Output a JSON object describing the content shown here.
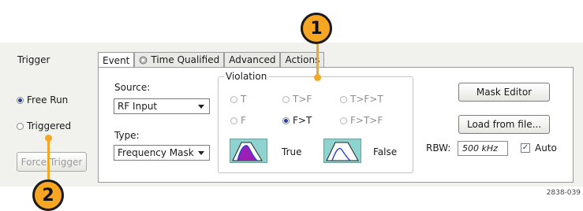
{
  "trigger": {
    "title": "Trigger",
    "free_run_label": "Free Run",
    "triggered_label": "Triggered",
    "force_trigger_label": "Force Trigger",
    "mode_selected": "Free Run"
  },
  "tabs": [
    "Event",
    "Time Qualified",
    "Advanced",
    "Actions"
  ],
  "event": {
    "source_label": "Source:",
    "source_value": "RF Input",
    "type_label": "Type:",
    "type_value": "Frequency Mask"
  },
  "violation": {
    "title": "Violation",
    "options": [
      "T",
      "T>F",
      "T>F>T",
      "F",
      "F>T",
      "F>T>F"
    ],
    "selected": "F>T",
    "true_label": "True",
    "false_label": "False"
  },
  "mask": {
    "mask_editor_label": "Mask Editor",
    "load_label": "Load from file...",
    "rbw_label": "RBW:",
    "rbw_value": "500 kHz",
    "auto_label": "Auto",
    "auto_checked": true
  },
  "callouts": [
    "1",
    "2"
  ],
  "figure_id": "2838-039",
  "colors": {
    "callout": "#f6a623",
    "mask_bg": "#8ed3cf",
    "mask_fill": "#9b1fb5",
    "selected_radio": "#1f3f9a"
  }
}
